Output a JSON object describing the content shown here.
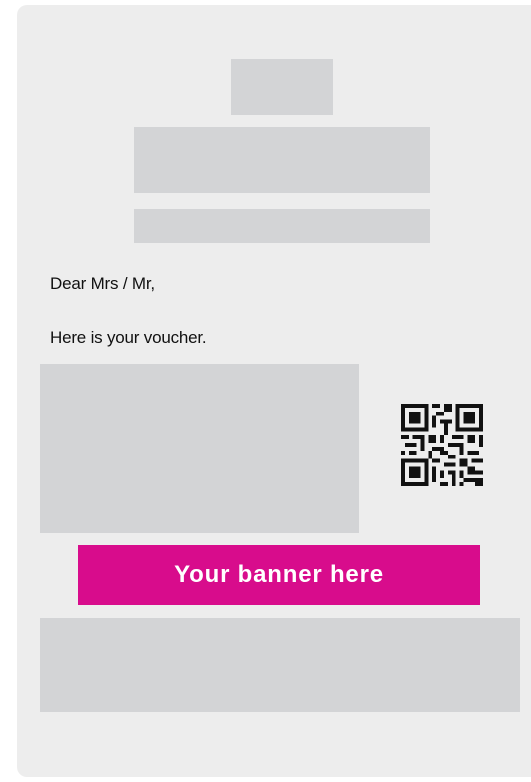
{
  "voucher": {
    "greeting": "Dear Mrs / Mr,",
    "message": "Here is your voucher.",
    "banner_text": "Your banner here",
    "qr_icon": "qr-code-icon"
  },
  "colors": {
    "card_background": "#ededed",
    "placeholder": "#d3d4d6",
    "banner": "#d80c8c",
    "banner_text": "#ffffff"
  }
}
